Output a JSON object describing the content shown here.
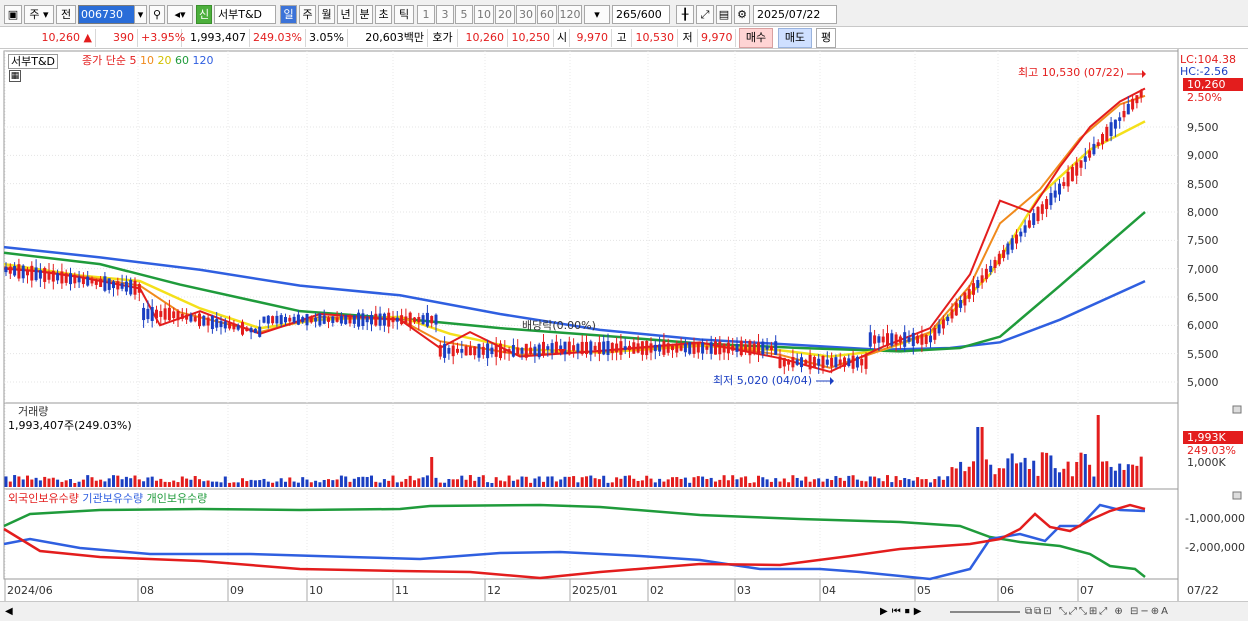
{
  "toolbar": {
    "period_type": "주",
    "prev": "전",
    "code": "006730",
    "shin": "신",
    "stock_name": "서부T&D",
    "periods": [
      "일",
      "주",
      "월",
      "년",
      "분",
      "초",
      "틱"
    ],
    "selected_period": "일",
    "intervals": [
      "1",
      "3",
      "5",
      "10",
      "20",
      "30",
      "60",
      "120"
    ],
    "count": "265",
    "count_max": "/600",
    "date": "2025/07/22"
  },
  "info": {
    "price": "10,260",
    "change": "390",
    "change_pct": "+3.95%",
    "volume": "1,993,407",
    "volume_ratio": "249.03%",
    "turnover": "3.05%",
    "trade_value": "20,603백만",
    "ask_label": "호가",
    "ask": "10,260",
    "bid": "10,250",
    "open_label": "시",
    "open": "9,970",
    "high_label": "고",
    "high": "10,530",
    "low_label": "저",
    "low": "9,970",
    "buy": "매수",
    "sell": "매도",
    "avg": "평"
  },
  "price_panel": {
    "name": "서부T&D",
    "legend_prefix": "종가 단순",
    "ma_labels": [
      "5",
      "10",
      "20",
      "60",
      "120"
    ],
    "ma_colors": [
      "#e31d1d",
      "#f08a1c",
      "#f4e01a",
      "#1f9b3b",
      "#2f5fe0"
    ],
    "lc": "LC:104.38",
    "hc": "HC:-2.56",
    "current_price_tag": "10,260",
    "current_pct_tag": "2.50%",
    "high_annot": "최고 10,530 (07/22)",
    "low_annot": "최저 5,020 (04/04)",
    "dividend_annot": "배당락(0.00%)",
    "y_ticks": [
      "9,500",
      "9,000",
      "8,500",
      "8,000",
      "7,500",
      "7,000",
      "6,500",
      "6,000",
      "5,500",
      "5,000"
    ]
  },
  "volume_panel": {
    "title": "거래량",
    "value": "1,993,407주(249.03%)",
    "tag_vol": "1,993K",
    "tag_pct": "249.03%",
    "y_tick": "1,000K"
  },
  "holding_panel": {
    "legend": [
      "외국인보유수량",
      "기관보유수량",
      "개인보유수량"
    ],
    "y_ticks": [
      "-1,000,000",
      "-2,000,000"
    ]
  },
  "x_axis": {
    "labels": [
      "2024/06",
      "08",
      "09",
      "10",
      "11",
      "12",
      "2025/01",
      "02",
      "03",
      "04",
      "05",
      "06",
      "07"
    ],
    "right_label": "07/22"
  },
  "colors": {
    "up": "#e31d1d",
    "down": "#1b3fc2",
    "foreign": "#e31d1d",
    "institution": "#2f5fe0",
    "individual": "#1f9b3b"
  }
}
